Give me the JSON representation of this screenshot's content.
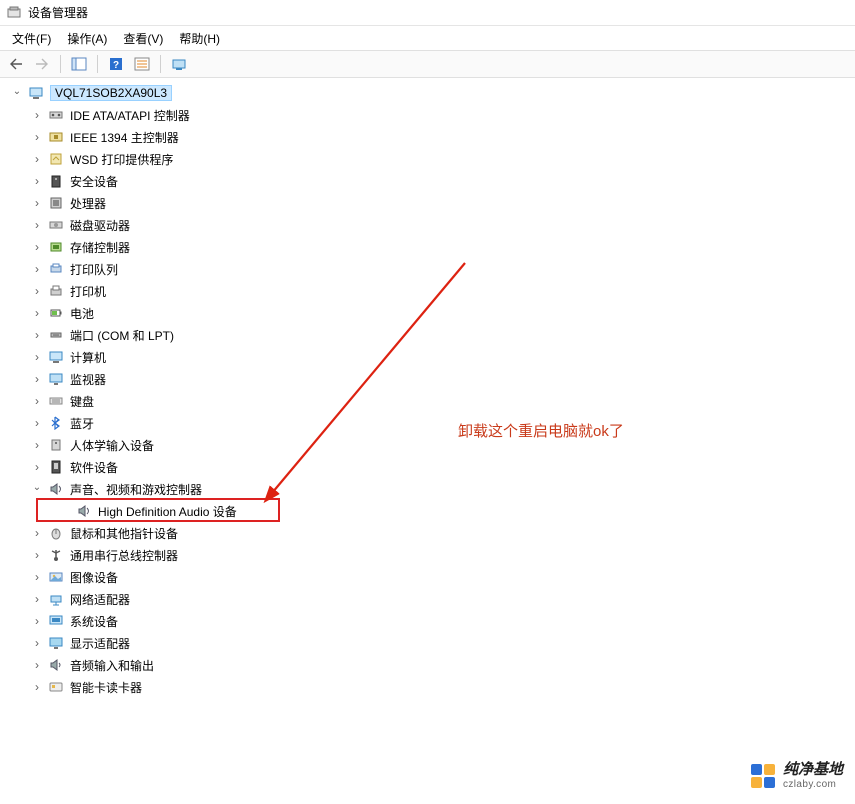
{
  "window": {
    "title": "设备管理器"
  },
  "menu": {
    "file": "文件(F)",
    "action": "操作(A)",
    "view": "查看(V)",
    "help": "帮助(H)"
  },
  "tree": {
    "root": "VQL71SOB2XA90L3",
    "items": [
      {
        "label": "IDE ATA/ATAPI 控制器",
        "icon": "ide"
      },
      {
        "label": "IEEE 1394 主控制器",
        "icon": "ieee"
      },
      {
        "label": "WSD 打印提供程序",
        "icon": "wsd"
      },
      {
        "label": "安全设备",
        "icon": "security"
      },
      {
        "label": "处理器",
        "icon": "cpu"
      },
      {
        "label": "磁盘驱动器",
        "icon": "disk"
      },
      {
        "label": "存储控制器",
        "icon": "storage"
      },
      {
        "label": "打印队列",
        "icon": "printq"
      },
      {
        "label": "打印机",
        "icon": "printer"
      },
      {
        "label": "电池",
        "icon": "battery"
      },
      {
        "label": "端口 (COM 和 LPT)",
        "icon": "port"
      },
      {
        "label": "计算机",
        "icon": "computer"
      },
      {
        "label": "监视器",
        "icon": "monitor"
      },
      {
        "label": "键盘",
        "icon": "keyboard"
      },
      {
        "label": "蓝牙",
        "icon": "bluetooth"
      },
      {
        "label": "人体学输入设备",
        "icon": "hid"
      },
      {
        "label": "软件设备",
        "icon": "software"
      },
      {
        "label": "声音、视频和游戏控制器",
        "icon": "sound",
        "expanded": true,
        "children": [
          {
            "label": "High Definition Audio 设备",
            "icon": "sound"
          }
        ]
      },
      {
        "label": "鼠标和其他指针设备",
        "icon": "mouse"
      },
      {
        "label": "通用串行总线控制器",
        "icon": "usb"
      },
      {
        "label": "图像设备",
        "icon": "image"
      },
      {
        "label": "网络适配器",
        "icon": "network"
      },
      {
        "label": "系统设备",
        "icon": "system"
      },
      {
        "label": "显示适配器",
        "icon": "display"
      },
      {
        "label": "音频输入和输出",
        "icon": "audio"
      },
      {
        "label": "智能卡读卡器",
        "icon": "smartcard"
      }
    ]
  },
  "annotation": {
    "text": "卸载这个重启电脑就ok了"
  },
  "watermark": {
    "title": "纯净基地",
    "sub": "czlaby.com"
  }
}
